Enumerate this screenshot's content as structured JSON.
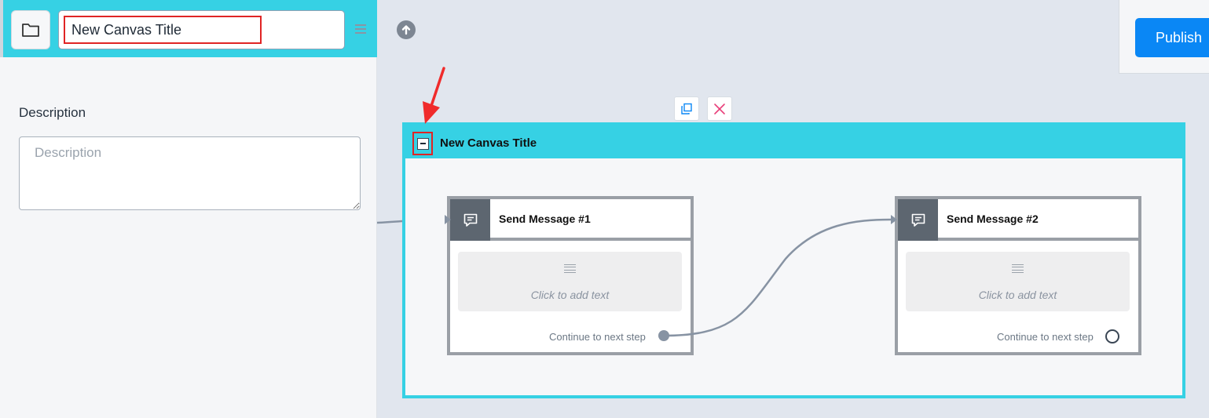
{
  "left_panel": {
    "folder_icon": "folder-icon",
    "title_value": "New Canvas Title",
    "menu_icon": "hamburger-icon",
    "description_label": "Description",
    "description_placeholder": "Description",
    "description_value": ""
  },
  "canvas": {
    "up_icon": "arrow-up-circle-icon",
    "publish_label": "Publish",
    "copy_icon": "duplicate-icon",
    "delete_icon": "close-icon",
    "group": {
      "collapse_icon": "collapse-minus-icon",
      "title": "New Canvas Title",
      "nodes": [
        {
          "title": "Send Message #1",
          "icon": "message-icon",
          "text_placeholder": "Click to add text",
          "continue_label": "Continue to next step",
          "port_connected": true
        },
        {
          "title": "Send Message #2",
          "icon": "message-icon",
          "text_placeholder": "Click to add text",
          "continue_label": "Continue to next step",
          "port_connected": false
        }
      ]
    }
  },
  "colors": {
    "header_cyan": "#36d1e4",
    "publish_blue": "#0a87f5",
    "highlight_red": "#e02424",
    "connector_gray": "#8793a3",
    "node_border": "#9a9fa6"
  }
}
